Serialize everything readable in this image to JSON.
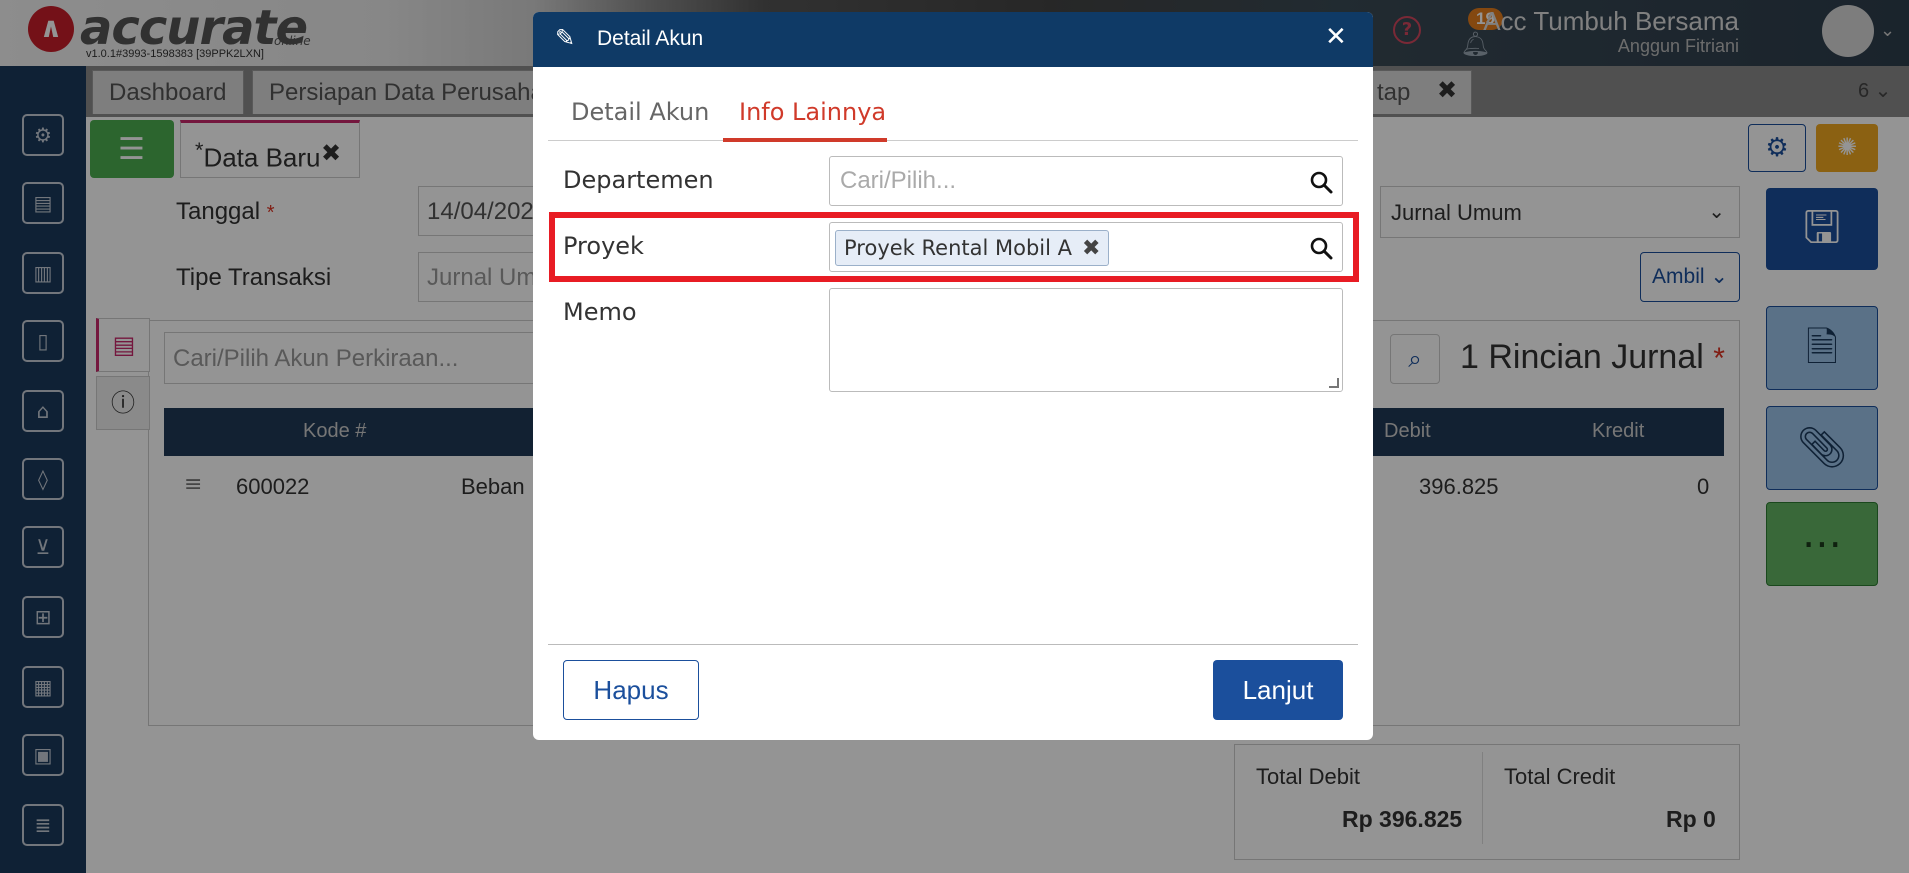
{
  "app": {
    "brand": "accurate",
    "brand_sub": "online",
    "version": "v1.0.1#3993-1598383 [39PPK2LXN]",
    "notification_count": "19",
    "company": "Acc Tumbuh Bersama",
    "user": "Anggun Fitriani"
  },
  "tabs": {
    "dashboard": "Dashboard",
    "persiapan": "Persiapan Data Perusaha",
    "partial": "tap",
    "count": "6"
  },
  "form": {
    "sub_tab_label": "Data Baru",
    "tanggal_label": "Tanggal",
    "tanggal_value": "14/04/202",
    "tipe_label": "Tipe Transaksi",
    "tipe_value": "Jurnal Um",
    "jurnal_select": "Jurnal Umum",
    "ambil_label": "Ambil",
    "account_search_placeholder": "Cari/Pilih Akun Perkiraan...",
    "rincian_title": "1 Rincian Jurnal",
    "required_mark": "*"
  },
  "table": {
    "headers": {
      "kode": "Kode #",
      "debit": "Debit",
      "kredit": "Kredit"
    },
    "rows": [
      {
        "kode": "600022",
        "nama": "Beban",
        "debit": "396.825",
        "kredit": "0"
      }
    ]
  },
  "totals": {
    "debit_label": "Total Debit",
    "debit_value": "Rp 396.825",
    "credit_label": "Total Credit",
    "credit_value": "Rp 0"
  },
  "modal": {
    "title": "Detail Akun",
    "tabs": [
      {
        "label": "Detail Akun",
        "active": false
      },
      {
        "label": "Info Lainnya",
        "active": true
      }
    ],
    "departemen_label": "Departemen",
    "departemen_placeholder": "Cari/Pilih...",
    "proyek_label": "Proyek",
    "proyek_chip": "Proyek Rental Mobil A",
    "memo_label": "Memo",
    "memo_value": "",
    "hapus_label": "Hapus",
    "lanjut_label": "Lanjut"
  },
  "colors": {
    "header_blue": "#0f3a66",
    "accent_red": "#d03a2a",
    "highlight_red": "#e81c24",
    "primary_blue": "#1b4f9c",
    "sidebar_navy": "#1b3a5c"
  }
}
